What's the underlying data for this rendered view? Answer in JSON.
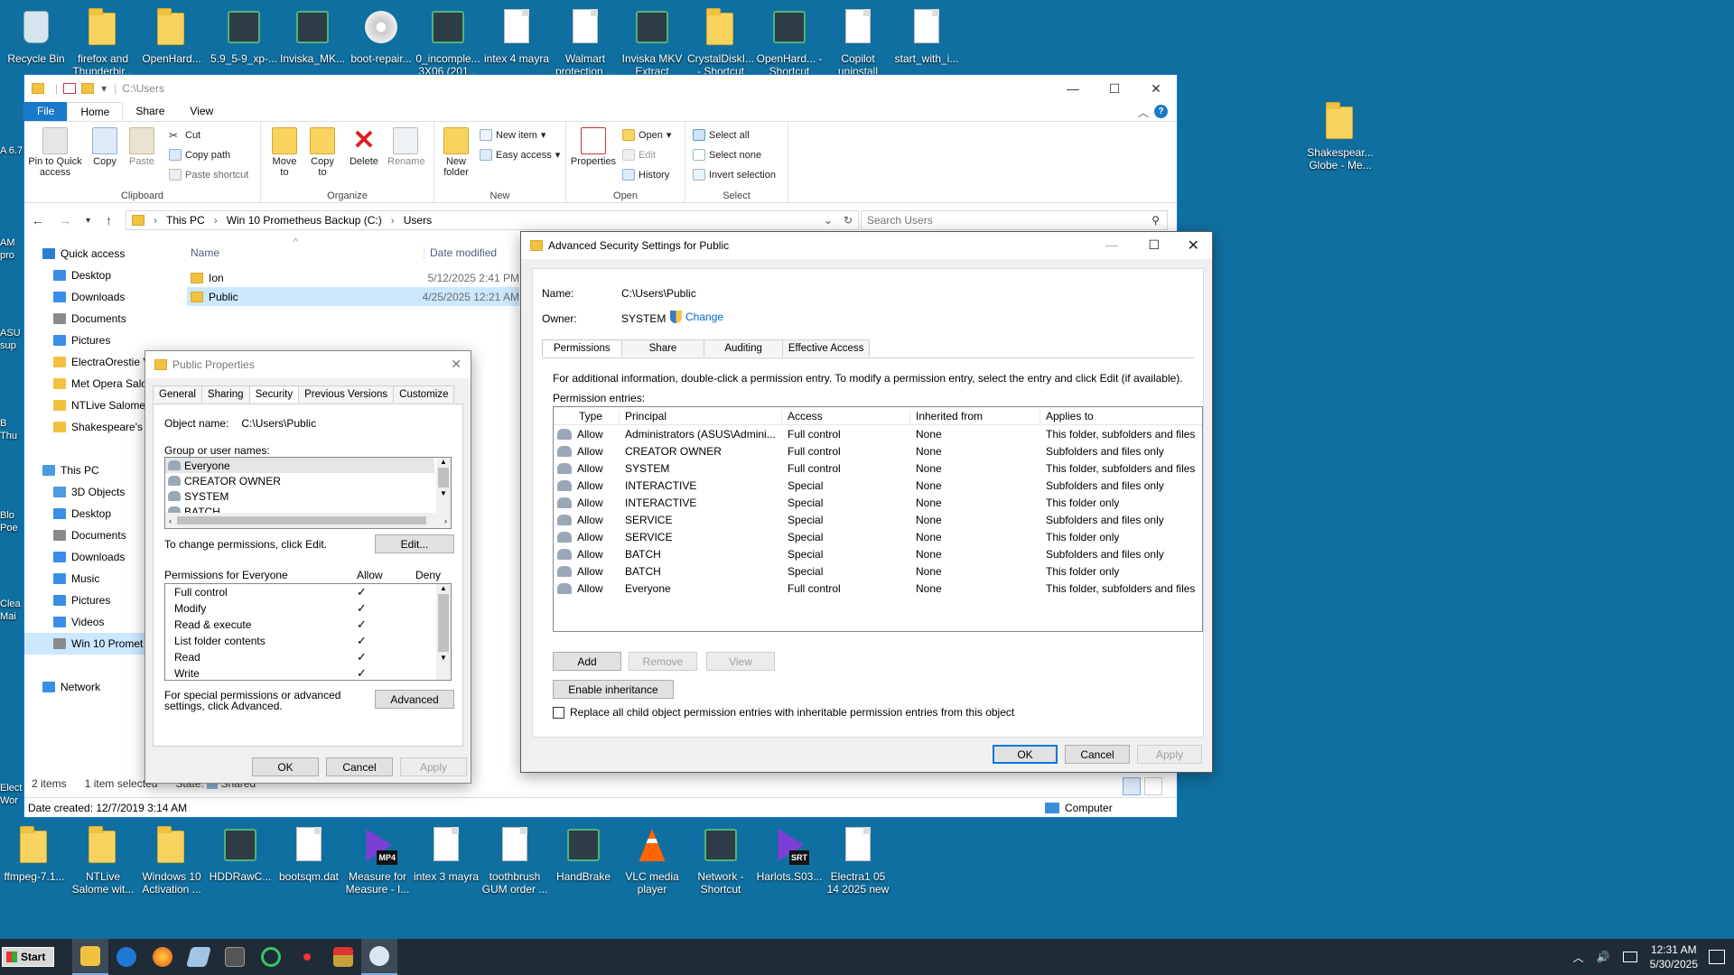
{
  "desktop": {
    "top_icons": [
      {
        "label": "Recycle Bin",
        "kind": "bin"
      },
      {
        "label": "firefox and Thunderbir...",
        "kind": "folder"
      },
      {
        "label": "OpenHard...",
        "kind": "folder"
      },
      {
        "label": "5.9_5-9_xp-...",
        "kind": "app"
      },
      {
        "label": "Inviska_MK...",
        "kind": "app"
      },
      {
        "label": "boot-repair...",
        "kind": "disc"
      },
      {
        "label": "0_incomple... 3X06 (201...",
        "kind": "app"
      },
      {
        "label": "intex 4 mayra",
        "kind": "doc"
      },
      {
        "label": "Walmart protection ...",
        "kind": "doc"
      },
      {
        "label": "Inviska MKV Extract",
        "kind": "app"
      },
      {
        "label": "CrystalDiskI... - Shortcut",
        "kind": "folder"
      },
      {
        "label": "OpenHard... - Shortcut",
        "kind": "app"
      },
      {
        "label": "Copilot uninstall",
        "kind": "doc"
      },
      {
        "label": "start_with_i...",
        "kind": "doc"
      }
    ],
    "right_icon": {
      "label": "Shakespear... Globe - Me..."
    },
    "left_partial": [
      "A 6.7",
      "AM pro",
      "ASU sup",
      "B Thu",
      "Blo Poe",
      "Clea Mai",
      "Elect Wor"
    ],
    "bottom_icons": [
      {
        "label": "ffmpeg-7.1...",
        "kind": "folder"
      },
      {
        "label": "NTLive Salome wit...",
        "kind": "folder"
      },
      {
        "label": "Windows 10 Activation ...",
        "kind": "folder"
      },
      {
        "label": "HDDRawC...",
        "kind": "app"
      },
      {
        "label": "bootsqm.dat",
        "kind": "doc"
      },
      {
        "label": "Measure for Measure - I...",
        "kind": "media",
        "badge": "MP4"
      },
      {
        "label": "intex 3 mayra",
        "kind": "doc"
      },
      {
        "label": "toothbrush GUM order ...",
        "kind": "doc"
      },
      {
        "label": "HandBrake",
        "kind": "app"
      },
      {
        "label": "VLC media player",
        "kind": "vlc"
      },
      {
        "label": "Network - Shortcut",
        "kind": "app"
      },
      {
        "label": "Harlots.S03...",
        "kind": "media",
        "badge": "SRT"
      },
      {
        "label": "Electra1 05 14 2025 new",
        "kind": "doc"
      }
    ]
  },
  "explorer": {
    "title": "C:\\Users",
    "controls": {
      "min": "—",
      "max": "☐",
      "close": "✕"
    },
    "ribbon_tabs": [
      "File",
      "Home",
      "Share",
      "View"
    ],
    "help": "?",
    "clipboard": {
      "pin": "Pin to Quick access",
      "copy": "Copy",
      "paste": "Paste",
      "cut": "Cut",
      "copy_path": "Copy path",
      "paste_shortcut": "Paste shortcut",
      "label": "Clipboard"
    },
    "organize": {
      "move": "Move to",
      "copy": "Copy to",
      "delete": "Delete",
      "rename": "Rename",
      "label": "Organize"
    },
    "new": {
      "new_folder": "New folder",
      "new_item": "New item",
      "easy_access": "Easy access",
      "label": "New"
    },
    "open": {
      "properties": "Properties",
      "open": "Open",
      "edit": "Edit",
      "history": "History",
      "label": "Open"
    },
    "select": {
      "all": "Select all",
      "none": "Select none",
      "invert": "Invert selection",
      "label": "Select"
    },
    "breadcrumb": [
      "This PC",
      "Win 10 Prometheus Backup (C:)",
      "Users"
    ],
    "search_placeholder": "Search Users",
    "nav": [
      {
        "label": "Quick access",
        "color": "#2a7ed3",
        "indent": 0
      },
      {
        "label": "Desktop",
        "color": "#3a8ee6",
        "indent": 1,
        "pin": true
      },
      {
        "label": "Downloads",
        "color": "#3a8ee6",
        "indent": 1,
        "pin": true
      },
      {
        "label": "Documents",
        "color": "#8a8a8a",
        "indent": 1
      },
      {
        "label": "Pictures",
        "color": "#3a8ee6",
        "indent": 1
      },
      {
        "label": "ElectraOrestie V",
        "color": "#f1c140",
        "indent": 1
      },
      {
        "label": "Met Opera Salo",
        "color": "#f1c140",
        "indent": 1
      },
      {
        "label": "NTLive Salome",
        "color": "#f1c140",
        "indent": 1
      },
      {
        "label": "Shakespeare's G",
        "color": "#f1c140",
        "indent": 1
      },
      {
        "label": "",
        "color": "transparent",
        "indent": 0
      },
      {
        "label": "This PC",
        "color": "#4a9be0",
        "indent": 0
      },
      {
        "label": "3D Objects",
        "color": "#4a9be0",
        "indent": 1
      },
      {
        "label": "Desktop",
        "color": "#3a8ee6",
        "indent": 1
      },
      {
        "label": "Documents",
        "color": "#8a8a8a",
        "indent": 1
      },
      {
        "label": "Downloads",
        "color": "#3a8ee6",
        "indent": 1
      },
      {
        "label": "Music",
        "color": "#3a8ee6",
        "indent": 1
      },
      {
        "label": "Pictures",
        "color": "#3a8ee6",
        "indent": 1
      },
      {
        "label": "Videos",
        "color": "#3a8ee6",
        "indent": 1
      },
      {
        "label": "Win 10 Promet",
        "color": "#8a8a8a",
        "indent": 1,
        "selected": true
      },
      {
        "label": "",
        "color": "transparent",
        "indent": 0
      },
      {
        "label": "Network",
        "color": "#3a8ee6",
        "indent": 0
      }
    ],
    "columns": {
      "name": "Name",
      "date": "Date modified"
    },
    "files": [
      {
        "name": "Ion",
        "date": "5/12/2025 2:41 PM"
      },
      {
        "name": "Public",
        "date": "4/25/2025 12:21 AM"
      }
    ],
    "status": {
      "items": "2 items",
      "selected": "1 item selected",
      "state": "State:",
      "shared": "Shared"
    },
    "details": {
      "date_created": "Date created: 12/7/2019 3:14 AM",
      "computer": "Computer"
    }
  },
  "props": {
    "title": "Public Properties",
    "tabs": [
      "General",
      "Sharing",
      "Security",
      "Previous Versions",
      "Customize"
    ],
    "object_label": "Object name:",
    "object_value": "C:\\Users\\Public",
    "group_label": "Group or user names:",
    "groups": [
      "Everyone",
      "CREATOR OWNER",
      "SYSTEM",
      "BATCH"
    ],
    "change_text": "To change permissions, click Edit.",
    "edit": "Edit...",
    "perm_for": "Permissions for Everyone",
    "allow": "Allow",
    "deny": "Deny",
    "perms": [
      "Full control",
      "Modify",
      "Read & execute",
      "List folder contents",
      "Read",
      "Write"
    ],
    "check": "✓",
    "special_text": "For special permissions or advanced settings, click Advanced.",
    "advanced": "Advanced",
    "ok": "OK",
    "cancel": "Cancel",
    "apply": "Apply"
  },
  "adv": {
    "title": "Advanced Security Settings for Public",
    "name_label": "Name:",
    "name_value": "C:\\Users\\Public",
    "owner_label": "Owner:",
    "owner_value": "SYSTEM",
    "change": "Change",
    "tabs": [
      "Permissions",
      "Share",
      "Auditing",
      "Effective Access"
    ],
    "info": "For additional information, double-click a permission entry. To modify a permission entry, select the entry and click Edit (if available).",
    "entries_label": "Permission entries:",
    "columns": [
      "Type",
      "Principal",
      "Access",
      "Inherited from",
      "Applies to"
    ],
    "rows": [
      [
        "Allow",
        "Administrators (ASUS\\Admini...",
        "Full control",
        "None",
        "This folder, subfolders and files"
      ],
      [
        "Allow",
        "CREATOR OWNER",
        "Full control",
        "None",
        "Subfolders and files only"
      ],
      [
        "Allow",
        "SYSTEM",
        "Full control",
        "None",
        "This folder, subfolders and files"
      ],
      [
        "Allow",
        "INTERACTIVE",
        "Special",
        "None",
        "Subfolders and files only"
      ],
      [
        "Allow",
        "INTERACTIVE",
        "Special",
        "None",
        "This folder only"
      ],
      [
        "Allow",
        "SERVICE",
        "Special",
        "None",
        "Subfolders and files only"
      ],
      [
        "Allow",
        "SERVICE",
        "Special",
        "None",
        "This folder only"
      ],
      [
        "Allow",
        "BATCH",
        "Special",
        "None",
        "Subfolders and files only"
      ],
      [
        "Allow",
        "BATCH",
        "Special",
        "None",
        "This folder only"
      ],
      [
        "Allow",
        "Everyone",
        "Full control",
        "None",
        "This folder, subfolders and files"
      ]
    ],
    "add": "Add",
    "remove": "Remove",
    "view": "View",
    "enable_inheritance": "Enable inheritance",
    "replace_text": "Replace all child object permission entries with inheritable permission entries from this object",
    "ok": "OK",
    "cancel": "Cancel",
    "apply": "Apply"
  },
  "taskbar": {
    "start": "Start",
    "time": "12:31 AM",
    "date": "5/30/2025"
  }
}
